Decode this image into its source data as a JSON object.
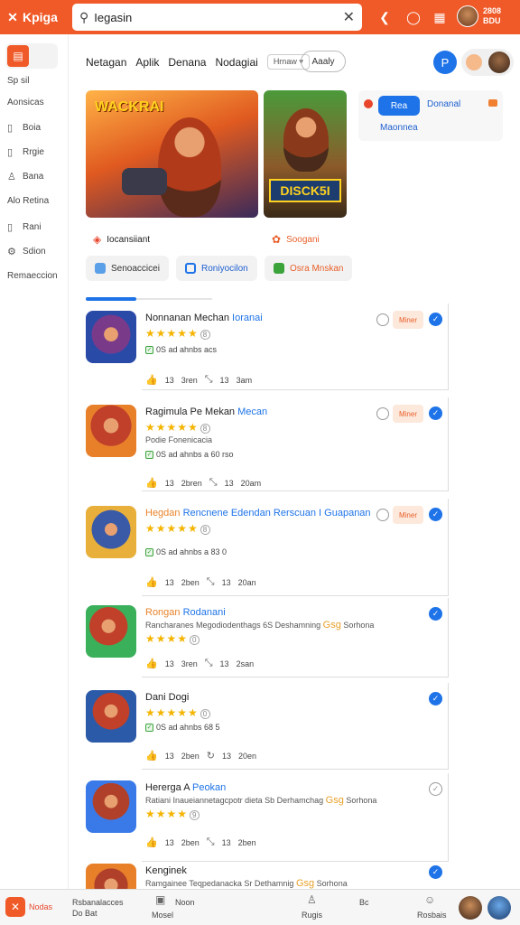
{
  "topbar": {
    "brand": "Kpiga",
    "search_value": "Iegasin",
    "user_lines": [
      "2808",
      "BDU"
    ]
  },
  "sidebar": {
    "items": [
      {
        "label": "Sp sil",
        "icon": "grid-icon"
      },
      {
        "label": "Aonsicas",
        "icon": ""
      },
      {
        "label": "Boia",
        "icon": "list-icon"
      },
      {
        "label": "Rrgie",
        "icon": "doc-icon"
      },
      {
        "label": "Bana",
        "icon": "bell-icon"
      },
      {
        "label": "Alo Retina",
        "icon": ""
      },
      {
        "label": "Rani",
        "icon": "list-icon"
      },
      {
        "label": "Sdion",
        "icon": "gear-icon"
      },
      {
        "label": "Remaeccion",
        "icon": ""
      }
    ]
  },
  "header": {
    "crumbs": [
      "Netagan",
      "Aplik",
      "Denana",
      "Nodagiai"
    ],
    "dropdown": "Hrnaw",
    "apply_label": "Aaaly",
    "circle_label": "P"
  },
  "hero": {
    "title1": "WACKRAI",
    "badge2": "DISCK5I"
  },
  "promo": {
    "button": "Rea",
    "title": "Donanal",
    "subtitle": "Maonnea"
  },
  "taglines": [
    {
      "label": "Iocansiiant",
      "color": "#333"
    },
    {
      "label": "Soogani",
      "color": "#e8602a"
    }
  ],
  "chips": [
    {
      "label": "Senoaccicei",
      "color": "#5aa0e8"
    },
    {
      "label": "Roniyocilon",
      "color": "#1e73e8"
    },
    {
      "label": "Osra Mnskan",
      "color": "#3aa33a"
    }
  ],
  "apps": [
    {
      "title": "Nonnanan Mechan",
      "title_hl": "Ioranai",
      "hl_class": "hl",
      "rating": "★★★★★",
      "rating_num": "8",
      "verified": "0S ad ahnbs acs",
      "meta": [
        "13",
        "3ren",
        "13",
        "3am"
      ],
      "action": "Miner",
      "has_radio": true,
      "check": "blue"
    },
    {
      "title": "Ragimula Pe Mekan",
      "title_hl": "Mecan",
      "hl_class": "hl",
      "rating": "★★★★★",
      "rating_num": "8",
      "desc": "Podie Fonenicacia",
      "verified": "0S ad ahnbs a 60 rso",
      "meta": [
        "13",
        "2bren",
        "13",
        "20am"
      ],
      "action": "Miner",
      "has_radio": true,
      "check": "blue"
    },
    {
      "title": "Hegdan",
      "title_hl": "Rencnene Edendan Rerscuan I Guapanan",
      "hl_class": "hl",
      "rating": "★★★★★",
      "rating_num": "8",
      "verified": "0S ad ahnbs a 83 0",
      "meta": [
        "13",
        "2ben",
        "13",
        "20an"
      ],
      "action": "Miner",
      "has_radio": true,
      "check": "blue"
    },
    {
      "title": "Rongan",
      "title_hl": "Rodanani",
      "hl_class": "hl",
      "rating": "★★★★",
      "rating_num": "0",
      "desc": "Rancharanes Megodiodenthags 6S Deshamning",
      "desc_hl": "Gsg",
      "desc_tail": "Sorhona",
      "meta": [
        "13",
        "3ren",
        "13",
        "2san"
      ],
      "action": "",
      "has_radio": false,
      "check": "blue"
    },
    {
      "title": "Dani Dogi",
      "title_hl": "",
      "hl_class": "hl",
      "rating": "★★★★★",
      "rating_num": "0",
      "verified": "0S ad ahnbs 68 5",
      "meta": [
        "13",
        "2ben",
        "13",
        "20en"
      ],
      "action": "",
      "has_radio": false,
      "check": "blue"
    },
    {
      "title": "Hererga A",
      "title_hl": "Peokan",
      "hl_class": "hl",
      "rating": "★★★★",
      "rating_num": "9",
      "desc": "Ratiani Inaueiannetagcpotr dieta Sb Derhamchag",
      "desc_hl": "Gsg",
      "desc_tail": "Sorhona",
      "meta": [
        "13",
        "2ben",
        "13",
        "2ben"
      ],
      "action": "",
      "has_radio": false,
      "check": "grey"
    },
    {
      "title": "Kenginek",
      "title_hl": "",
      "hl_class": "hl",
      "rating": "",
      "rating_num": "",
      "desc": "Ramgainee Teqpedanacka Sr Dethamnig",
      "desc_hl": "Gsg",
      "desc_tail": "Sorhona",
      "meta": [],
      "action": "",
      "has_radio": false,
      "check": "blue"
    }
  ],
  "bottombar": {
    "brand": "Nodas",
    "col1": [
      "Rsbanalacces",
      "Do       Bat"
    ],
    "col2": "Noon",
    "col2b": "Mosel",
    "col3": "Rugis",
    "col4": "Bc",
    "col5": "Rosbais"
  }
}
